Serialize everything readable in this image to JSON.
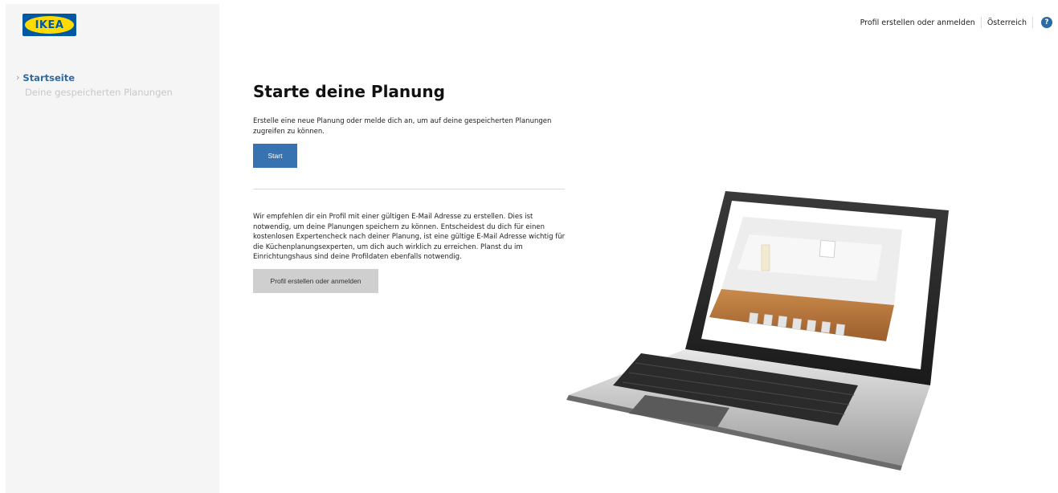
{
  "brand": {
    "logo_text": "IKEA",
    "blue": "#0058a3",
    "yellow": "#ffdb00"
  },
  "sidebar": {
    "items": [
      {
        "label": "Startseite",
        "active": true
      },
      {
        "label": "Deine gespeicherten Planungen",
        "active": false
      }
    ]
  },
  "topbar": {
    "profile_link": "Profil erstellen oder anmelden",
    "country": "Österreich",
    "help_icon": "?"
  },
  "main": {
    "title": "Starte deine Planung",
    "intro": "Erstelle eine neue Planung oder melde dich an, um auf deine gespeicherten Planungen zugreifen zu können.",
    "start_button": "Start",
    "recommendation": "Wir empfehlen dir ein Profil mit einer gültigen E-Mail Adresse zu erstellen. Dies ist notwendig, um deine Planungen speichern zu können. Entscheidest du dich für einen kostenlosen Expertencheck nach deiner Planung, ist eine gültige E-Mail Adresse wichtig für die Küchenplanungsexperten, um dich auch wirklich zu erreichen. Planst du im Einrichtungshaus sind deine Profildaten ebenfalls notwendig.",
    "profile_button": "Profil erstellen oder anmelden"
  },
  "colors": {
    "accent": "#3773b0",
    "active_nav": "#2c6aa6",
    "muted_nav": "#c8c8c8",
    "secondary_button": "#cfcfcf"
  }
}
